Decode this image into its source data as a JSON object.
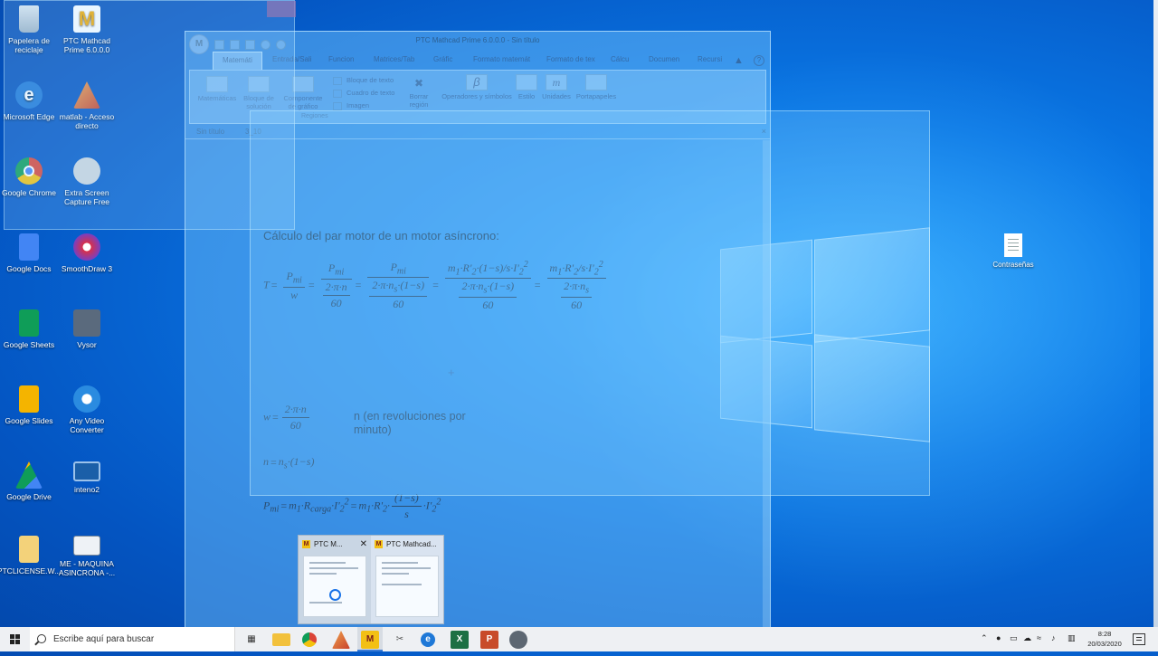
{
  "desktop": {
    "icons": [
      {
        "label": "Papelera de reciclaje"
      },
      {
        "label": "PTC Mathcad Prime 6.0.0.0"
      },
      {
        "label": "Microsoft Edge"
      },
      {
        "label": "matlab - Acceso directo"
      },
      {
        "label": "Google Chrome"
      },
      {
        "label": "Extra Screen Capture Free"
      },
      {
        "label": "Google Docs"
      },
      {
        "label": "SmoothDraw 3"
      },
      {
        "label": "Google Sheets"
      },
      {
        "label": "Vysor"
      },
      {
        "label": "Google Slides"
      },
      {
        "label": "Any Video Converter"
      },
      {
        "label": "Google Drive"
      },
      {
        "label": "inteno2"
      },
      {
        "label": "PTCLICENSE.W..."
      },
      {
        "label": "ME - MAQUINA ASINCRONA -..."
      }
    ],
    "file_right": {
      "label": "Contraseñas"
    }
  },
  "mathcad": {
    "title": "PTC Mathcad Prime 6.0.0.0 - Sin título",
    "logo_letter": "M",
    "tabs": [
      "Matemáti",
      "Entrada/Sali",
      "Funcion",
      "Matrices/Tab",
      "Gráfic",
      "Formato matemát",
      "Formato de tex",
      "Cálcu",
      "Documen",
      "Recursi"
    ],
    "ribbon": {
      "matematicas": "Matemáticas",
      "bloque_solucion": "Bloque de solución",
      "componente_grafico": "Componente de gráfico",
      "bloque_texto": "Bloque de texto",
      "cuadro_texto": "Cuadro de texto",
      "imagen": "Imagen",
      "borrar_region": "Borrar región",
      "operadores": "Operadores y símbolos",
      "estilo": "Estilo",
      "unidades": "Unidades",
      "portapapeles": "Portapapeles",
      "regiones": "Regiones"
    },
    "doc_tabs": [
      "Sin título",
      "3_10"
    ],
    "worksheet": {
      "heading": "Cálculo del par motor de un motor asíncrono:",
      "note": "n (en revoluciones por minuto)"
    }
  },
  "preview": {
    "items": [
      {
        "title": "PTC M..."
      },
      {
        "title": "PTC Mathcad..."
      }
    ],
    "close": "✕"
  },
  "taskbar": {
    "search_placeholder": "Escribe aquí para buscar",
    "time": "8:28",
    "date": "20/03/2020"
  }
}
